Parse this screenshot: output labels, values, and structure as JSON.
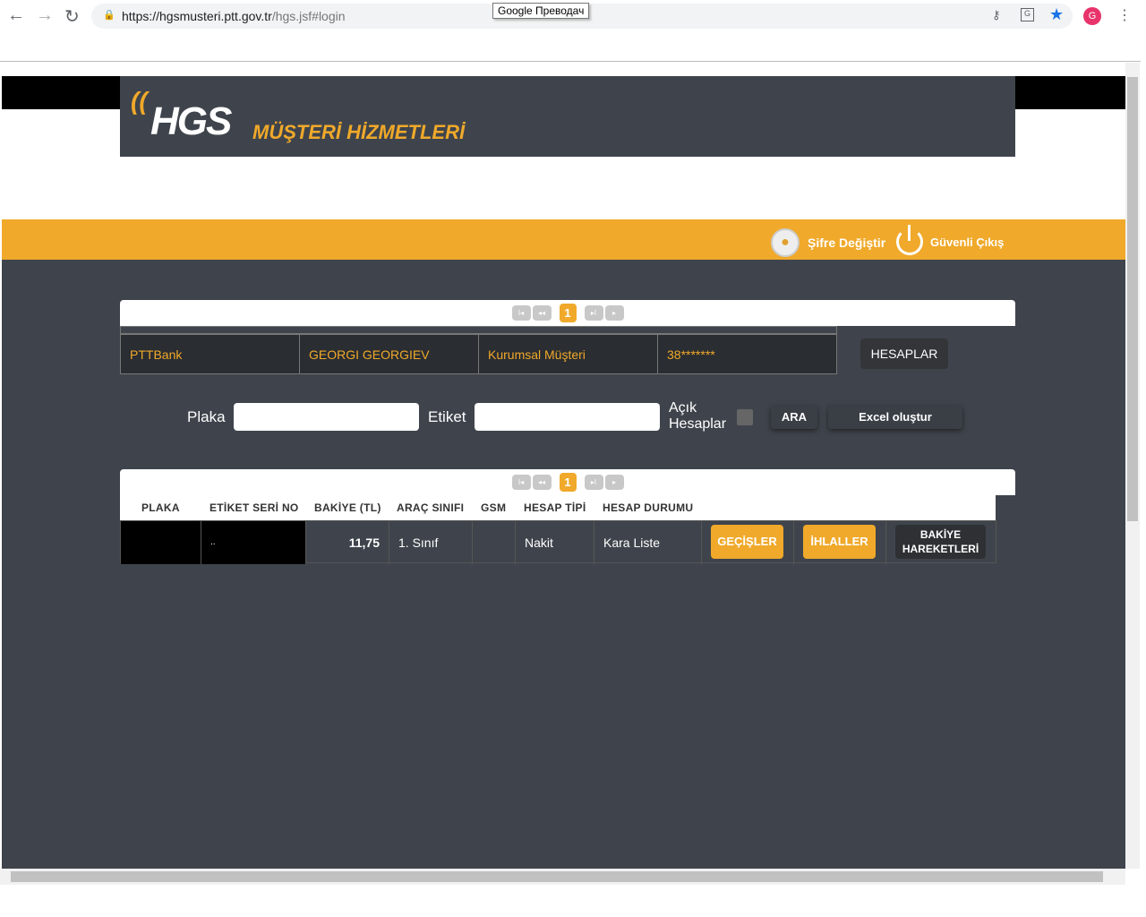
{
  "browser": {
    "url_host": "https://hgsmusteri.ptt.gov.tr",
    "url_path": "/hgs.jsf#login",
    "tooltip": "Google Преводач",
    "profile_initial": "G"
  },
  "header": {
    "logo_text": "HGS",
    "logo_subtitle": "MÜŞTERİ HİZMETLERİ"
  },
  "topbar": {
    "change_password": "Şifre Değiştir",
    "logout": "Güvenli Çıkış"
  },
  "pagination": {
    "first": "I◂",
    "prev": "◂◂",
    "current": "1",
    "next": "▸I",
    "last": "▸"
  },
  "account": {
    "bank": "PTTBank",
    "name": "GEORGI GEORGIEV",
    "type": "Kurumsal Müşteri",
    "number": "38*******",
    "accounts_button": "HESAPLAR"
  },
  "search": {
    "plate_label": "Plaka",
    "plate_value": "",
    "tag_label": "Etiket",
    "tag_value": "",
    "open_accounts_label_1": "Açık",
    "open_accounts_label_2": "Hesaplar",
    "search_button": "ARA",
    "excel_button": "Excel oluştur"
  },
  "table": {
    "columns": [
      "PLAKA",
      "ETİKET SERİ NO",
      "BAKİYE (TL)",
      "ARAÇ SINIFI",
      "GSM",
      "HESAP TİPİ",
      "HESAP DURUMU"
    ],
    "rows": [
      {
        "plate": "",
        "tag": "..",
        "balance": "11,75",
        "vehicle_class": "1. Sınıf",
        "gsm": "",
        "account_type": "Nakit",
        "status": "Kara Liste"
      }
    ],
    "actions": {
      "passes": "GEÇİŞLER",
      "violations": "İHLALLER",
      "balance_line1": "BAKİYE",
      "balance_line2": "HAREKETLERİ"
    }
  },
  "colors": {
    "accent": "#f0a92a",
    "background": "#3f444c"
  }
}
